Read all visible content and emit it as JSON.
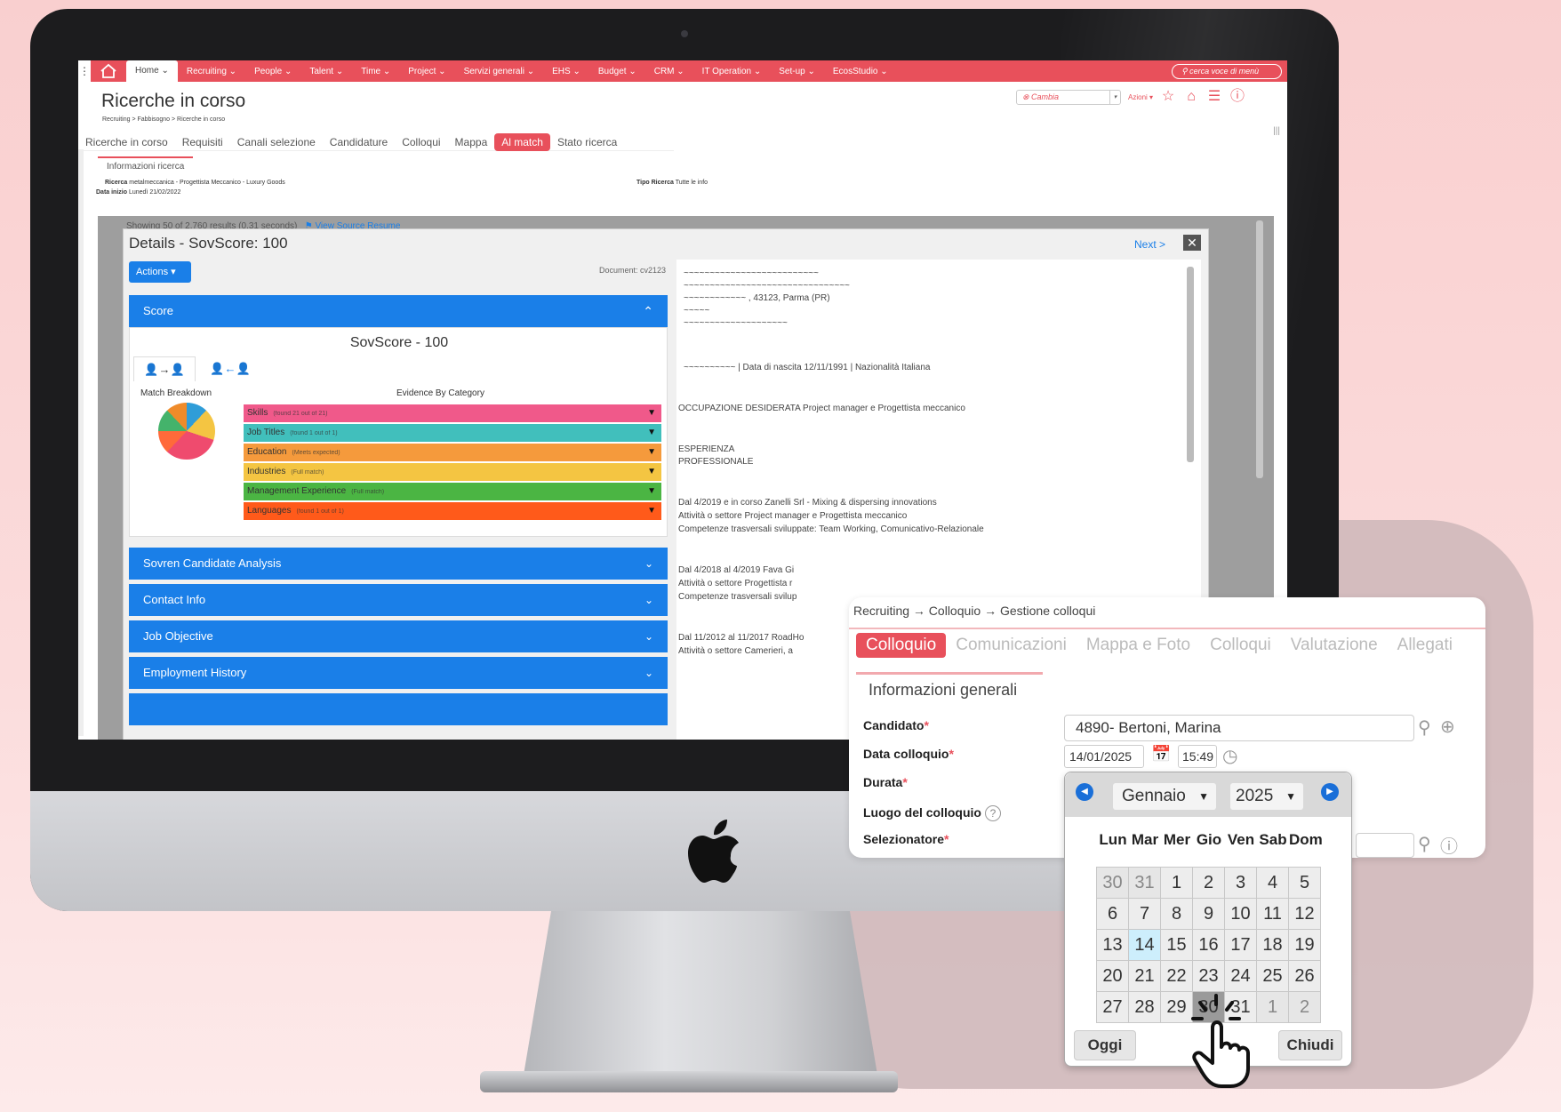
{
  "topnav": {
    "items": [
      "Home",
      "Recruiting",
      "People",
      "Talent",
      "Time",
      "Project",
      "Servizi generali",
      "EHS",
      "Budget",
      "CRM",
      "IT Operation",
      "Set-up",
      "EcosStudio"
    ],
    "search_placeholder": "cerca voce di menù"
  },
  "page": {
    "title": "Ricerche in corso",
    "breadcrumb": "Recruiting > Fabbisogno > Ricerche in corso",
    "cambia": "Cambia",
    "azioni": "Azioni"
  },
  "subtabs": [
    "Ricerche in corso",
    "Requisiti",
    "Canali selezione",
    "Candidature",
    "Colloqui",
    "Mappa",
    "Al match",
    "Stato ricerca"
  ],
  "info": {
    "tab_label": "Informazioni ricerca",
    "ricerca_label": "Ricerca",
    "ricerca_value": "metalmeccanica - Progettista Meccanico - Luxury Goods",
    "tipo_label": "Tipo Ricerca",
    "tipo_value": "Tutte le info",
    "data_label": "Data inizio",
    "data_value": "Lunedì 21/02/2022"
  },
  "details": {
    "showing": "Showing 50 of 2,760 results (0.31 seconds)",
    "view_source": "View Source Resume",
    "title": "Details - SovScore: 100",
    "next": "Next >",
    "actions": "Actions",
    "document": "Document: cv2123",
    "score_header": "Score",
    "sov_title": "SovScore - 100",
    "match_breakdown": "Match Breakdown",
    "evidence_by_category": "Evidence By Category",
    "categories": [
      {
        "name": "Skills",
        "detail": "(found 21 out of 21)",
        "color": "#f0598a"
      },
      {
        "name": "Job Titles",
        "detail": "(found 1 out of 1)",
        "color": "#41bfbc"
      },
      {
        "name": "Education",
        "detail": "(Meets expected)",
        "color": "#f59a3c"
      },
      {
        "name": "Industries",
        "detail": "(Full match)",
        "color": "#f4c542"
      },
      {
        "name": "Management Experience",
        "detail": "(Full match)",
        "color": "#4bb543"
      },
      {
        "name": "Languages",
        "detail": "(found 1 out of 1)",
        "color": "#ff5a1a"
      }
    ],
    "accordions": [
      "Sovren Candidate Analysis",
      "Contact Info",
      "Job Objective",
      "Employment History"
    ]
  },
  "resume": {
    "lines": [
      "~~~~~~~~~~~~~~~~~~~~~~~~~~",
      "~~~~~~~~~~~~~~~~~~~~~~~~~~~~~~~~",
      "~~~~~~~~~~~~ , 43123, Parma (PR)",
      "~~~~~",
      "~~~~~~~~~~~~~~~~~~~~",
      "~~~~~~~~~~  | Data di nascita 12/11/1991 | Nazionalità Italiana",
      "OCCUPAZIONE DESIDERATA     Project manager e Progettista meccanico",
      "ESPERIENZA",
      "PROFESSIONALE",
      "Dal 4/2019 e in corso   Zanelli Srl - Mixing & dispersing innovations",
      "Attività o settore Project manager e Progettista meccanico",
      "Competenze trasversali sviluppate: Team Working, Comunicativo-Relazionale",
      "Dal 4/2018 al 4/2019   Fava Gi",
      "Attività o settore Progettista r",
      "Competenze trasversali svilup",
      "Dal 11/2012 al 11/2017   RoadHo",
      "Attività o settore Camerieri, a"
    ]
  },
  "colloquio": {
    "breadcrumb": "Recruiting  →  Colloquio  →  Gestione colloqui",
    "tabs": [
      "Colloquio",
      "Comunicazioni",
      "Mappa e Foto",
      "Colloqui",
      "Valutazione",
      "Allegati"
    ],
    "section": "Informazioni generali",
    "labels": {
      "candidato": "Candidato",
      "data": "Data colloquio",
      "durata": "Durata",
      "luogo": "Luogo del colloquio",
      "selezionatore": "Selezionatore"
    },
    "candidato_value": "4890- Bertoni, Marina",
    "data_value": "14/01/2025",
    "ora_value": "15:49"
  },
  "datepicker": {
    "month": "Gennaio",
    "year": "2025",
    "dow": [
      "Lun",
      "Mar",
      "Mer",
      "Gio",
      "Ven",
      "Sab",
      "Dom"
    ],
    "days": [
      "30",
      "31",
      "1",
      "2",
      "3",
      "4",
      "5",
      "6",
      "7",
      "8",
      "9",
      "10",
      "11",
      "12",
      "13",
      "14",
      "15",
      "16",
      "17",
      "18",
      "19",
      "20",
      "21",
      "22",
      "23",
      "24",
      "25",
      "26",
      "27",
      "28",
      "29",
      "30",
      "31",
      "1",
      "2"
    ],
    "today": "14",
    "selected": "30",
    "oggi": "Oggi",
    "chiudi": "Chiudi"
  },
  "colors": {
    "brand": "#e8505b",
    "accent_blue": "#1a7fe8"
  }
}
